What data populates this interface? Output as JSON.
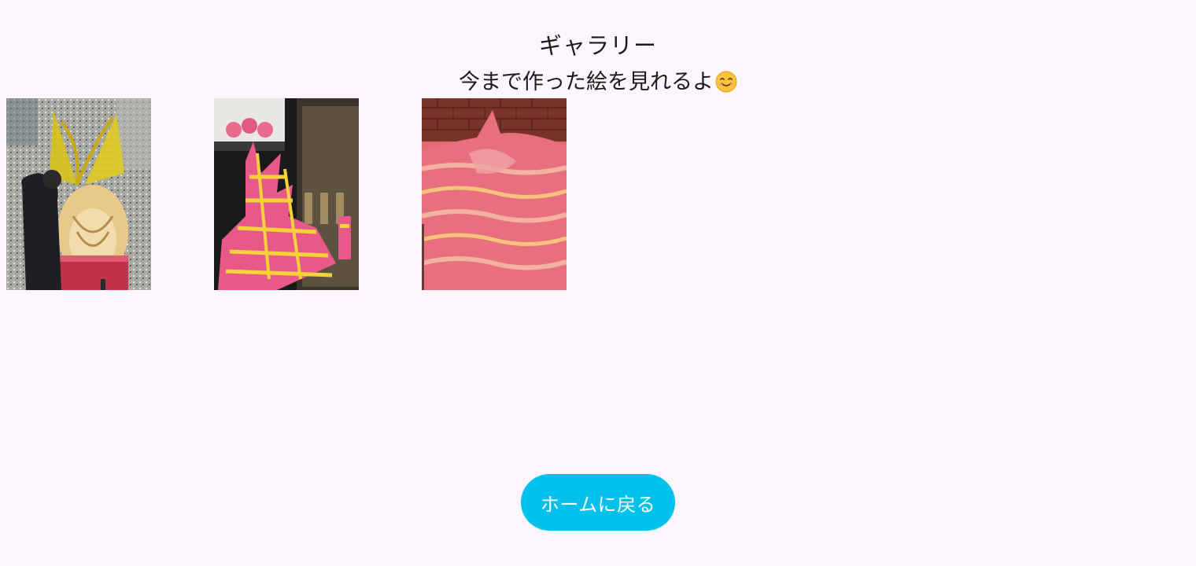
{
  "header": {
    "title": "ギャラリー",
    "subtitle": "今まで作った絵を見れるよ",
    "subtitle_emoji": "smiling-face-emoji"
  },
  "gallery": {
    "items": [
      {
        "icon": "phoenix-artwork-thumbnail"
      },
      {
        "icon": "castle-artwork-thumbnail"
      },
      {
        "icon": "wave-artwork-thumbnail"
      }
    ]
  },
  "footer": {
    "home_button_label": "ホームに戻る"
  },
  "colors": {
    "background": "#fdf6fd",
    "button": "#00c0ec",
    "button_text": "#ffffff",
    "text": "#1a1a1a"
  }
}
